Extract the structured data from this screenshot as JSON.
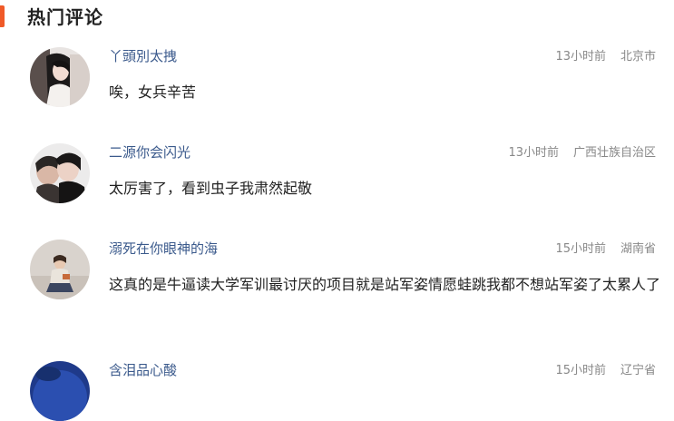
{
  "section": {
    "title": "热门评论"
  },
  "colors": {
    "accent": "#f05a28",
    "username": "#3b5a8c",
    "meta": "#888888",
    "text": "#222222"
  },
  "comments": [
    {
      "username": "丫頭別太拽",
      "time": "13小时前",
      "location": "北京市",
      "text": "唉，女兵辛苦",
      "avatar": "avatar-woman-long-hair"
    },
    {
      "username": "二源你会闪光",
      "time": "13小时前",
      "location": "广西壮族自治区",
      "text": "太厉害了，看到虫子我肃然起敬",
      "avatar": "avatar-couple"
    },
    {
      "username": "溺死在你眼神的海",
      "time": "15小时前",
      "location": "湖南省",
      "text": "这真的是牛逼读大学军训最讨厌的项目就是站军姿情愿蛙跳我都不想站军姿了太累人了",
      "avatar": "avatar-girl-sitting"
    },
    {
      "username": "含泪品心酸",
      "time": "15小时前",
      "location": "辽宁省",
      "text": "",
      "avatar": "avatar-dark-blue"
    }
  ]
}
